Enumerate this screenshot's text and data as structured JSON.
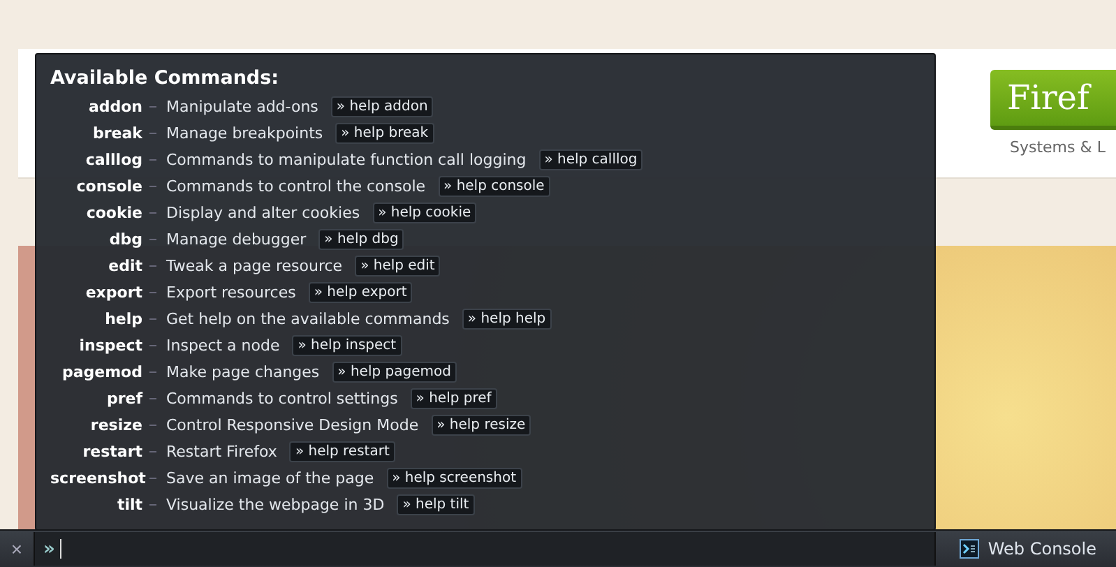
{
  "page": {
    "download_button": "Firef",
    "caption": "Systems & L"
  },
  "output": {
    "title": "Available Commands:",
    "commands": [
      {
        "name": "addon",
        "description": "Manipulate add-ons",
        "help": "» help addon"
      },
      {
        "name": "break",
        "description": "Manage breakpoints",
        "help": "» help break"
      },
      {
        "name": "calllog",
        "description": "Commands to manipulate function call logging",
        "help": "» help calllog"
      },
      {
        "name": "console",
        "description": "Commands to control the console",
        "help": "» help console"
      },
      {
        "name": "cookie",
        "description": "Display and alter cookies",
        "help": "» help cookie"
      },
      {
        "name": "dbg",
        "description": "Manage debugger",
        "help": "» help dbg"
      },
      {
        "name": "edit",
        "description": "Tweak a page resource",
        "help": "» help edit"
      },
      {
        "name": "export",
        "description": "Export resources",
        "help": "» help export"
      },
      {
        "name": "help",
        "description": "Get help on the available commands",
        "help": "» help help"
      },
      {
        "name": "inspect",
        "description": "Inspect a node",
        "help": "» help inspect"
      },
      {
        "name": "pagemod",
        "description": "Make page changes",
        "help": "» help pagemod"
      },
      {
        "name": "pref",
        "description": "Commands to control settings",
        "help": "» help pref"
      },
      {
        "name": "resize",
        "description": "Control Responsive Design Mode",
        "help": "» help resize"
      },
      {
        "name": "restart",
        "description": "Restart Firefox",
        "help": "» help restart"
      },
      {
        "name": "screenshot",
        "description": "Save an image of the page",
        "help": "» help screenshot"
      },
      {
        "name": "tilt",
        "description": "Visualize the webpage in 3D",
        "help": "» help tilt"
      }
    ]
  },
  "toolbar": {
    "close": "×",
    "prompt": "»",
    "tool_button": "Web Console"
  }
}
